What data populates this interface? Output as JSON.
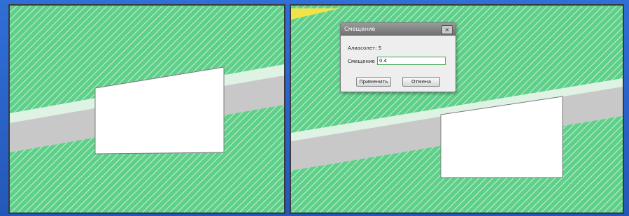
{
  "dialog": {
    "title": "Смещение",
    "close_glyph": "×",
    "alias_label": "Алиасолет:",
    "alias_value": "5",
    "offset_label": "Смещение",
    "offset_value": "0.4",
    "apply_label": "Применить",
    "cancel_label": "Отмена"
  },
  "colors": {
    "hatch_fill": "#5fd08a",
    "hatch_line": "#e6f7ea",
    "road": "#c8c8c8",
    "building": "#ffffff",
    "background": "#2a63c9",
    "highlight": "#f2e24a"
  }
}
